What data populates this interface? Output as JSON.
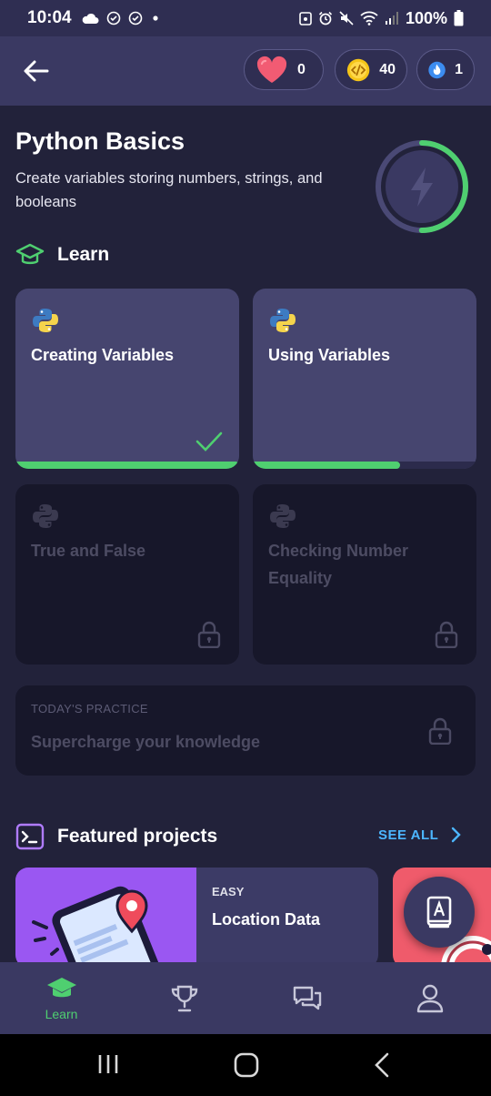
{
  "status_bar": {
    "time": "10:04",
    "battery": "100%",
    "icons_left": [
      "cloud-icon",
      "check-circle-icon",
      "check-circle-icon",
      "dot-icon"
    ],
    "icons_right": [
      "nfc-icon",
      "alarm-icon",
      "mute-icon",
      "wifi-icon",
      "signal-icon",
      "battery-icon"
    ]
  },
  "header": {
    "hearts": "0",
    "coins": "40",
    "streak": "1"
  },
  "course": {
    "title": "Python Basics",
    "subtitle": "Create variables storing numbers, strings, and booleans",
    "progress_fraction": 0.5
  },
  "learn_section": {
    "label": "Learn"
  },
  "lessons": [
    {
      "name": "Creating Variables",
      "state": "completed",
      "progress": 1.0
    },
    {
      "name": "Using Variables",
      "state": "in-progress",
      "progress": 0.66
    },
    {
      "name": "True and False",
      "state": "locked",
      "progress": 0
    },
    {
      "name": "Checking Number Equality",
      "state": "locked",
      "progress": 0
    }
  ],
  "practice": {
    "kicker": "TODAY'S PRACTICE",
    "description": "Supercharge your knowledge"
  },
  "featured": {
    "label": "Featured projects",
    "see_all": "SEE ALL",
    "projects": [
      {
        "difficulty": "EASY",
        "name": "Location Data"
      }
    ]
  },
  "bottom_nav": {
    "items": [
      {
        "label": "Learn",
        "icon": "graduation-cap-icon",
        "active": true
      },
      {
        "label": "",
        "icon": "trophy-icon",
        "active": false
      },
      {
        "label": "",
        "icon": "chat-icon",
        "active": false
      },
      {
        "label": "",
        "icon": "profile-icon",
        "active": false
      }
    ]
  },
  "colors": {
    "accent_green": "#4fcf70",
    "link_blue": "#4cb6ff",
    "card_active": "#46456f",
    "card_locked": "#17172a",
    "background": "#22223a"
  }
}
